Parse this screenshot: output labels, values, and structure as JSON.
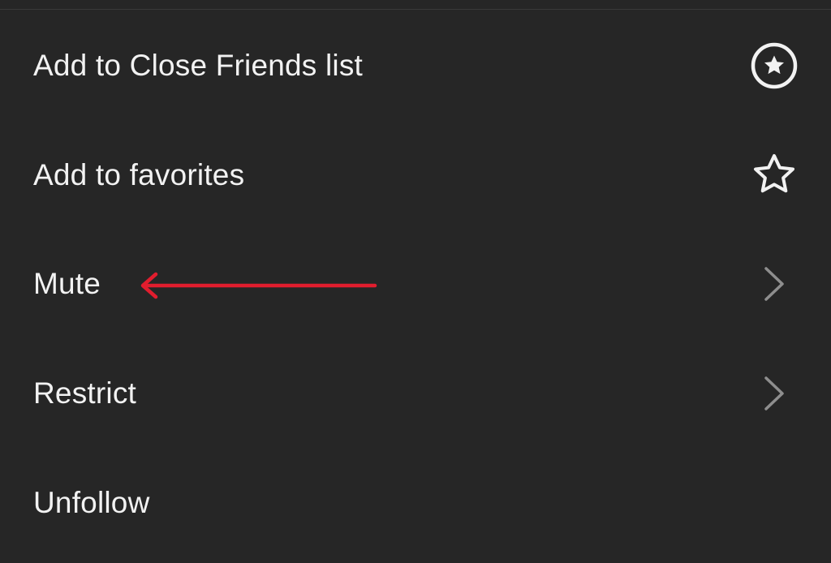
{
  "menu": {
    "items": [
      {
        "label": "Add to Close Friends list",
        "icon": "close-friends-star-circle-icon"
      },
      {
        "label": "Add to favorites",
        "icon": "star-outline-icon"
      },
      {
        "label": "Mute",
        "icon": "chevron-right-icon"
      },
      {
        "label": "Restrict",
        "icon": "chevron-right-icon"
      },
      {
        "label": "Unfollow",
        "icon": ""
      }
    ]
  },
  "annotation": {
    "type": "arrow",
    "points_to": "Mute",
    "color": "#e11d2e"
  },
  "colors": {
    "background": "#262626",
    "text": "#f2f2f2",
    "chevron": "#8e8e8e",
    "annotation": "#e11d2e"
  }
}
